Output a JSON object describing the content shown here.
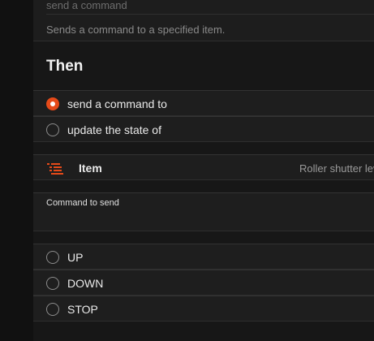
{
  "action": {
    "command_title": "send a command",
    "command_description": "Sends a command to a specified item."
  },
  "then_heading": "Then",
  "mode_options": [
    {
      "label": "send a command to",
      "selected": true
    },
    {
      "label": "update the state of",
      "selected": false
    }
  ],
  "item": {
    "label": "Item",
    "value": "Roller shutter lev",
    "icon": "list-icon"
  },
  "command_field": {
    "label": "Command to send",
    "value": ""
  },
  "command_options": [
    {
      "label": "UP",
      "selected": false
    },
    {
      "label": "DOWN",
      "selected": false
    },
    {
      "label": "STOP",
      "selected": false
    }
  ],
  "colors": {
    "accent": "#e64a19",
    "background": "#171717",
    "row": "#1e1e1e"
  }
}
